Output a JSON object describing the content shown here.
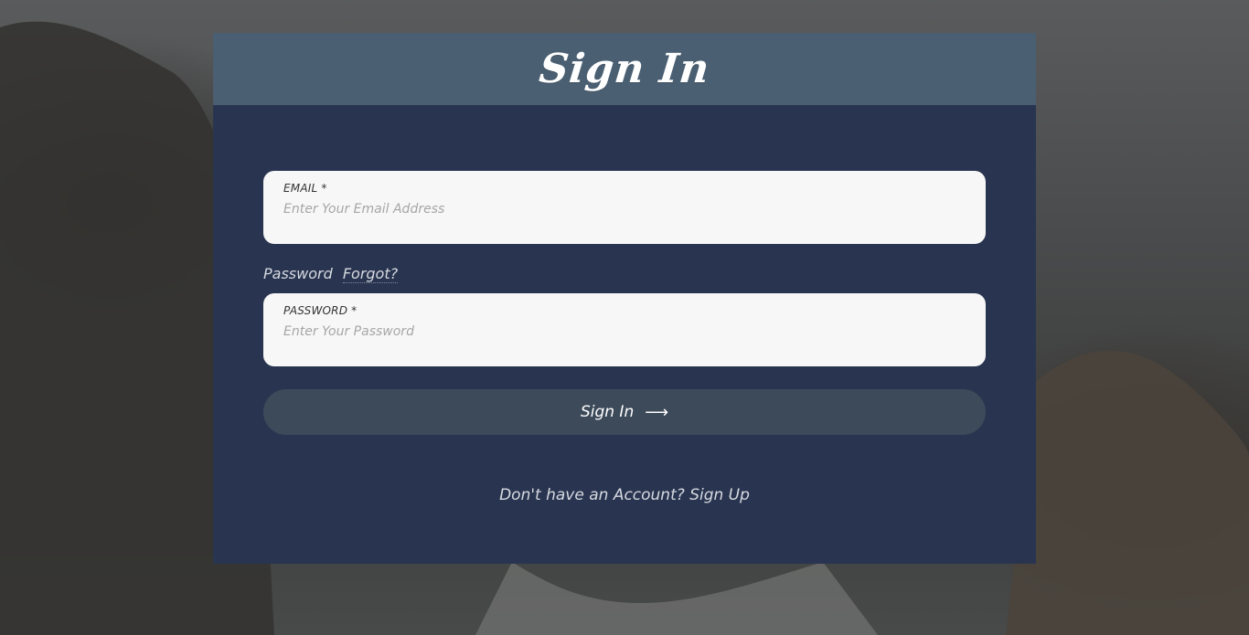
{
  "header": {
    "title": "Sign In"
  },
  "email_field": {
    "label": "EMAIL *",
    "placeholder": "Enter Your Email Address",
    "value": ""
  },
  "password_section": {
    "caption": "Password",
    "forgot_link": "Forgot?"
  },
  "password_field": {
    "label": "PASSWORD *",
    "placeholder": "Enter Your Password",
    "value": ""
  },
  "submit": {
    "label": "Sign In",
    "icon": "arrow-right-icon"
  },
  "footer": {
    "prompt": "Don't have an Account?",
    "signup_link": "Sign Up"
  },
  "colors": {
    "card_body": "#293550",
    "card_header": "#4a5f72",
    "button": "#3d4a5a",
    "input_bg": "#f7f7f7"
  }
}
